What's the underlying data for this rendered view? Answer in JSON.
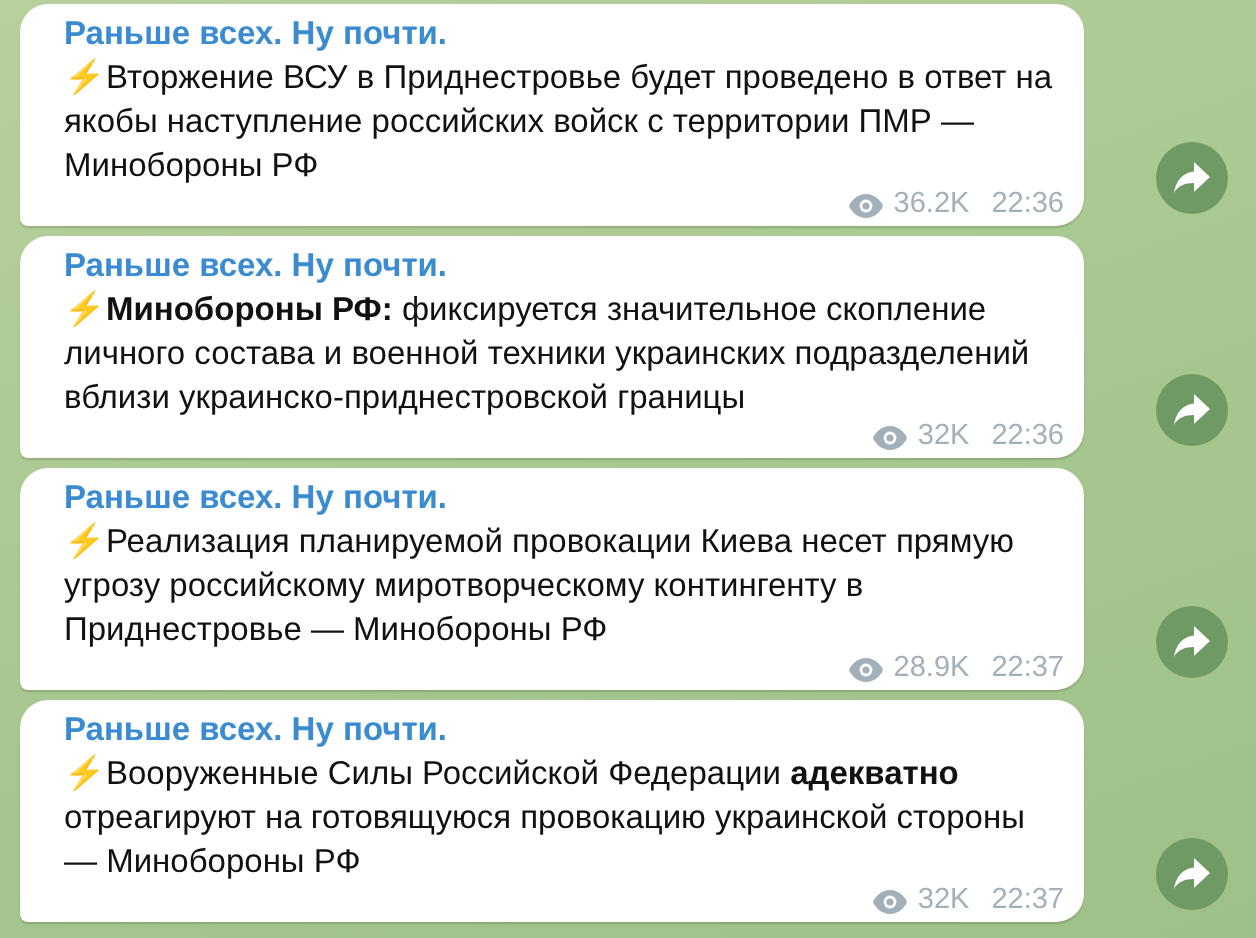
{
  "messages": [
    {
      "channel": "Раньше всех. Ну почти.",
      "text": "⚡️Вторжение ВСУ в Приднестровье будет проведено в ответ на якобы наступление российских войск с территории ПМР — Минобороны РФ",
      "views": "36.2K",
      "time": "22:36"
    },
    {
      "channel": "Раньше всех. Ну почти.",
      "text": "⚡️**Минобороны РФ:** фиксируется значительное скопление личного состава и военной техники украинских подразделений вблизи украинско-приднестровской границы",
      "views": "32K",
      "time": "22:36"
    },
    {
      "channel": "Раньше всех. Ну почти.",
      "text": "⚡️Реализация планируемой провокации Киева несет прямую угрозу российскому миротворческому контингенту в Приднестровье — Минобороны РФ",
      "views": "28.9K",
      "time": "22:37"
    },
    {
      "channel": "Раньше всех. Ну почти.",
      "text": "⚡️Вооруженные Силы Российской Федерации **адекватно** отреагируют на готовящуюся провокацию украинской стороны — Минобороны РФ",
      "views": "32K",
      "time": "22:37"
    }
  ]
}
